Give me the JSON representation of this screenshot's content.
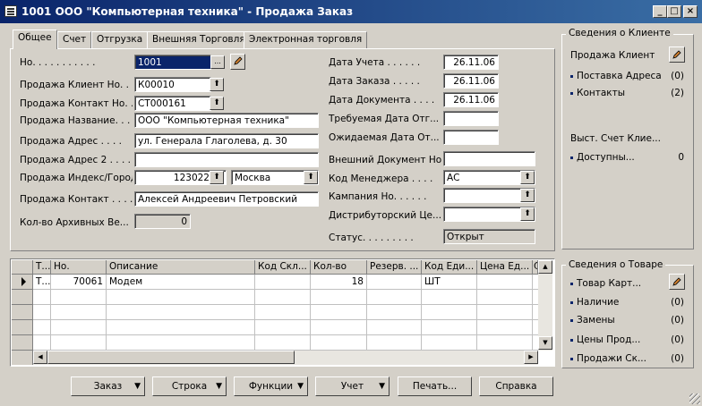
{
  "window": {
    "title": "1001 ООО \"Компьютерная техника\" - Продажа Заказ",
    "min": "_",
    "max": "□",
    "close": "×"
  },
  "tabs": [
    "Общее",
    "Счет",
    "Отгрузка",
    "Внешняя Торговля",
    "Электронная торговля"
  ],
  "left": {
    "no_label": "Но. . . . . . . . . . .",
    "no_value": "1001",
    "cust_no_label": "Продажа Клиент Но. . .",
    "cust_no_value": "К00010",
    "contact_no_label": "Продажа Контакт Но. . .",
    "contact_no_value": "СТ000161",
    "name_label": "Продажа Название. . . .",
    "name_value": "ООО \"Компьютерная техника\"",
    "addr_label": "Продажа Адрес . . . .",
    "addr_value": "ул. Генерала Глаголева, д. 30",
    "addr2_label": "Продажа Адрес 2 . . . .",
    "addr2_value": "",
    "zip_label": "Продажа Индекс/Город",
    "zip_value": "123022",
    "city_value": "Москва",
    "contact_label": "Продажа Контакт . . . .",
    "contact_value": "Алексей Андреевич Петровский",
    "archive_label": "Кол-во Архивных Ве...",
    "archive_value": "0"
  },
  "right": {
    "post_date_label": "Дата Учета . . . . . .",
    "post_date_value": "26.11.06",
    "order_date_label": "Дата Заказа . . . . .",
    "order_date_value": "26.11.06",
    "doc_date_label": "Дата Документа . . . .",
    "doc_date_value": "26.11.06",
    "req_date_label": "Требуемая Дата Отг...",
    "req_date_value": "",
    "prom_date_label": "Ожидаемая Дата От...",
    "prom_date_value": "",
    "ext_doc_label": "Внешний Документ Но...",
    "ext_doc_value": "",
    "manager_label": "Код Менеджера . . . .",
    "manager_value": "АС",
    "campaign_label": "Кампания Но. . . . . .",
    "campaign_value": "",
    "distrib_label": "Дистрибуторский Це...",
    "distrib_value": "",
    "status_label": "Статус. . . . . . . . .",
    "status_value": "Открыт"
  },
  "customer_panel": {
    "title": "Сведения о Клиенте",
    "header": "Продажа Клиент",
    "ship_addr": "Поставка Адреса",
    "ship_addr_count": "(0)",
    "contacts": "Контакты",
    "contacts_count": "(2)",
    "bill_header": "Выст. Счет Клие...",
    "available": "Доступны...",
    "available_count": "0"
  },
  "item_panel": {
    "title": "Сведения о Товаре",
    "item_card": "Товар Карт...",
    "availability": "Наличие",
    "availability_count": "(0)",
    "substitutes": "Замены",
    "substitutes_count": "(0)",
    "prices": "Цены Прод...",
    "prices_count": "(0)",
    "discounts": "Продажи Ск...",
    "discounts_count": "(0)"
  },
  "grid": {
    "headers": [
      "Т...",
      "Но.",
      "Описание",
      "Код Скл...",
      "Кол-во",
      "Резерв. ...",
      "Код Еди...",
      "Цена Ед...",
      "С"
    ],
    "row": {
      "type": "Т...",
      "no": "70061",
      "desc": "Модем",
      "loc": "",
      "qty": "18",
      "res": "",
      "uom": "ШТ",
      "price": ""
    }
  },
  "buttons": {
    "order": "Заказ",
    "line": "Строка",
    "functions": "Функции",
    "post": "Учет",
    "print": "Печать...",
    "help": "Справка"
  }
}
